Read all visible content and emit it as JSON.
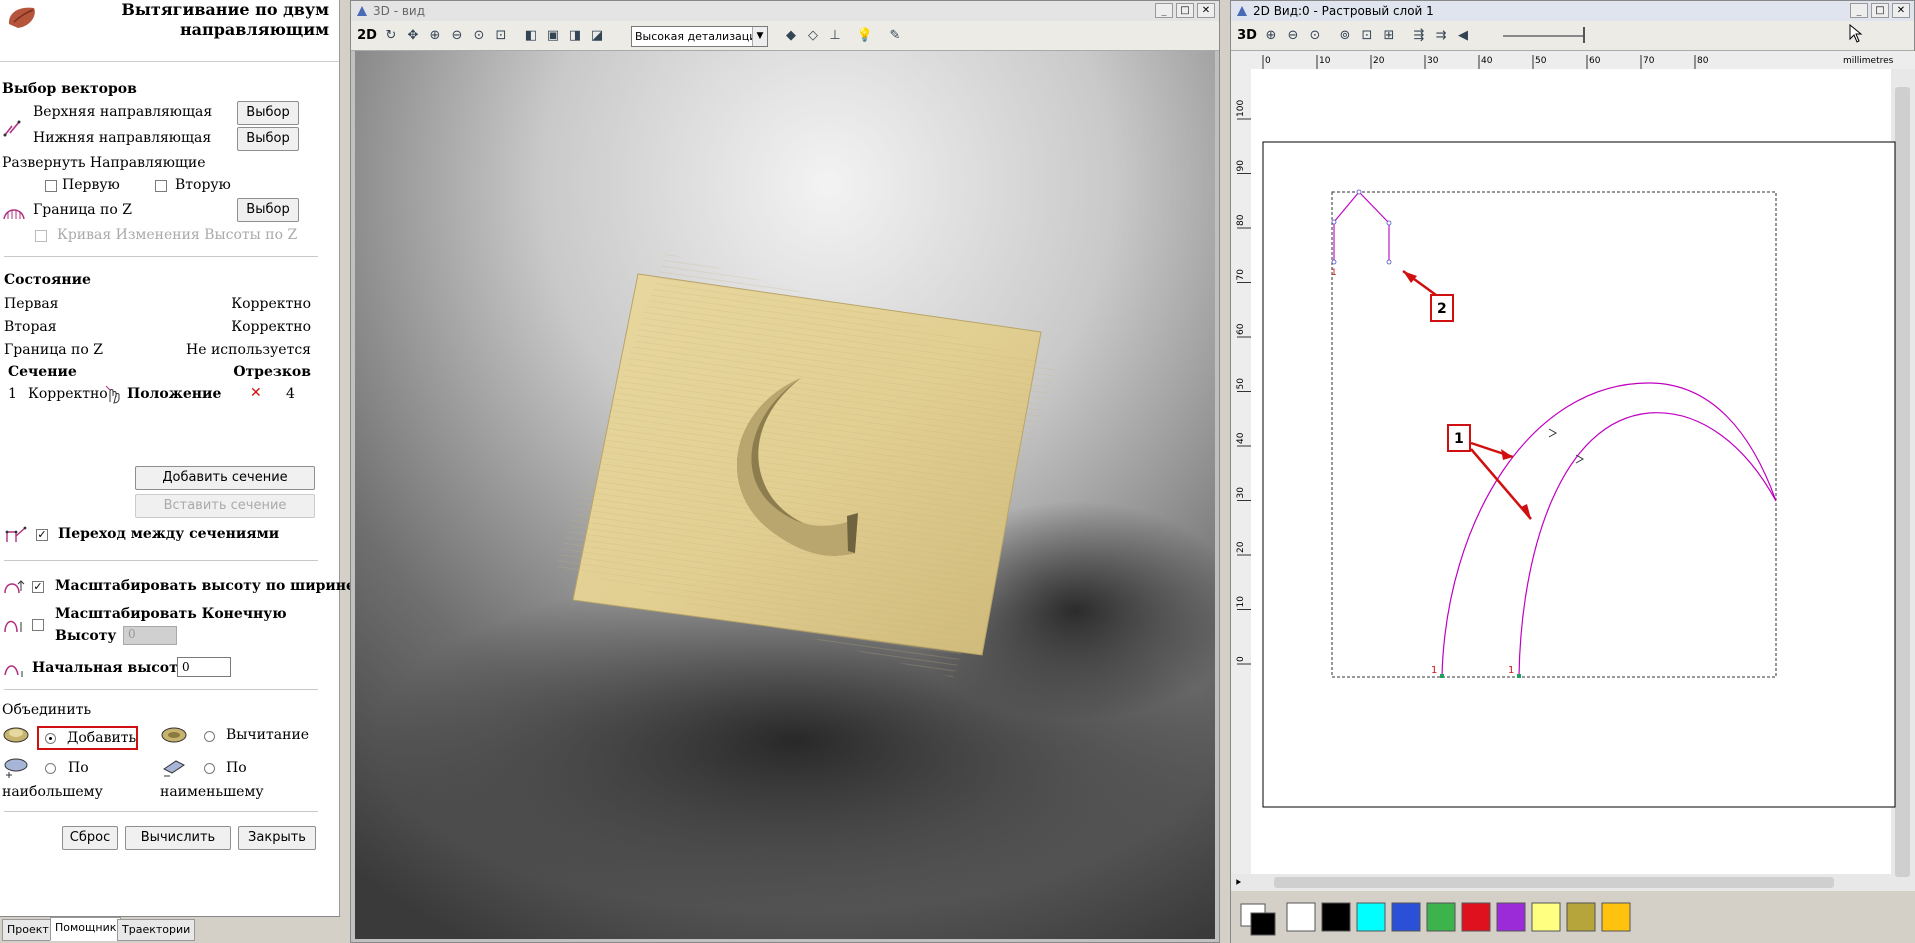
{
  "left_panel": {
    "title_line1": "Вытягивание по двум",
    "title_line2": "направляющим",
    "vectors_section": "Выбор векторов",
    "upper_rail_label": "Верхняя направляющая",
    "lower_rail_label": "Нижняя направляющая",
    "select_label": "Выбор",
    "reverse_rails": "Развернуть Направляющие",
    "first_label": "Первую",
    "second_label": "Вторую",
    "z_boundary_label": "Граница по Z",
    "height_curve_label": "Кривая Изменения Высоты по Z",
    "state_section": "Состояние",
    "state_rows": [
      {
        "name": "Первая",
        "value": "Корректно"
      },
      {
        "name": "Вторая",
        "value": "Корректно"
      },
      {
        "name": "Граница по Z",
        "value": "Не используется"
      }
    ],
    "section_col": "Сечение",
    "segments_col": "Отрезков",
    "section_row": {
      "index": "1",
      "status": "Корректно",
      "position": "Положение",
      "count": "4"
    },
    "add_section": "Добавить сечение",
    "insert_section": "Вставить сечение",
    "transition_label": "Переход между сечениями",
    "scale_height_label": "Масштабировать высоту по ширине",
    "scale_end_line1": "Масштабировать Конечную",
    "scale_end_line2": "Высоту",
    "scale_end_value": "0",
    "start_height_label": "Начальная высота",
    "start_height_value": "0",
    "combine_section": "Объединить",
    "combine_add": "Добавить",
    "combine_subtract": "Вычитание",
    "combine_max_1": "По",
    "combine_max_2": "наибольшему",
    "combine_min_1": "По",
    "combine_min_2": "наименьшему",
    "reset_btn": "Сброс",
    "calc_btn": "Вычислить",
    "close_btn": "Закрыть",
    "tabs": [
      "Проект",
      "Помощник",
      "Траектории"
    ]
  },
  "view3d": {
    "title": "3D - вид",
    "btn_2d": "2D",
    "detail_select": "Высокая детализация"
  },
  "view2d": {
    "title": "2D Вид:0 - Растровый слой 1",
    "btn_3d": "3D",
    "units": "millimetres",
    "x_ticks": [
      "0",
      "10",
      "20",
      "30",
      "40",
      "50",
      "60",
      "70",
      "80"
    ],
    "y_ticks": [
      "100",
      "90",
      "80",
      "70",
      "60",
      "50",
      "40",
      "30",
      "20",
      "10",
      "0"
    ],
    "callout_1": "1",
    "callout_2": "2",
    "start_marker": "1",
    "palette": [
      "#ffffff",
      "#000000",
      "#00ffff",
      "#2b50d8",
      "#3cb44b",
      "#e0111e",
      "#9b2bd8",
      "#ffff80",
      "#b5a53a",
      "#ffc20e"
    ]
  }
}
